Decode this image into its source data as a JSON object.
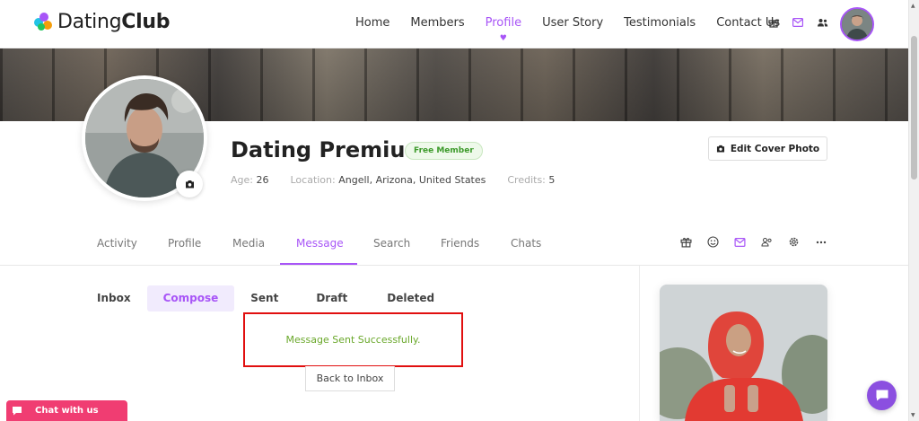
{
  "brand": {
    "name_light": "Dating",
    "name_bold": "Club",
    "accent": "#a855f7"
  },
  "nav": {
    "items": [
      {
        "label": "Home"
      },
      {
        "label": "Members"
      },
      {
        "label": "Profile",
        "active": true
      },
      {
        "label": "User Story"
      },
      {
        "label": "Testimonials"
      },
      {
        "label": "Contact Us"
      }
    ],
    "icons": [
      "gift-icon",
      "mail-icon",
      "friends-icon"
    ]
  },
  "profile": {
    "name": "Dating Premium",
    "badge": "Free Member",
    "age_label": "Age:",
    "age": "26",
    "location_label": "Location:",
    "location": "Angell, Arizona, United States",
    "credits_label": "Credits:",
    "credits": "5",
    "edit_cover_label": "Edit Cover Photo"
  },
  "tabs": {
    "items": [
      {
        "label": "Activity"
      },
      {
        "label": "Profile"
      },
      {
        "label": "Media"
      },
      {
        "label": "Message",
        "active": true
      },
      {
        "label": "Search"
      },
      {
        "label": "Friends"
      },
      {
        "label": "Chats"
      }
    ],
    "icons": [
      "gift-icon",
      "smiley-icon",
      "mail-icon",
      "friends-icon",
      "settings-icon",
      "more-icon"
    ]
  },
  "messages": {
    "subtabs": [
      {
        "label": "Inbox"
      },
      {
        "label": "Compose",
        "active": true
      },
      {
        "label": "Sent"
      },
      {
        "label": "Draft"
      },
      {
        "label": "Deleted"
      }
    ],
    "success_text": "Message Sent Successfully.",
    "back_label": "Back to Inbox"
  },
  "chat": {
    "label": "Chat with us"
  },
  "colors": {
    "success": "#6aa82b",
    "highlight_border": "#e10f0f",
    "chat_tab": "#f03d72",
    "chat_fab": "#8b4fe0"
  }
}
